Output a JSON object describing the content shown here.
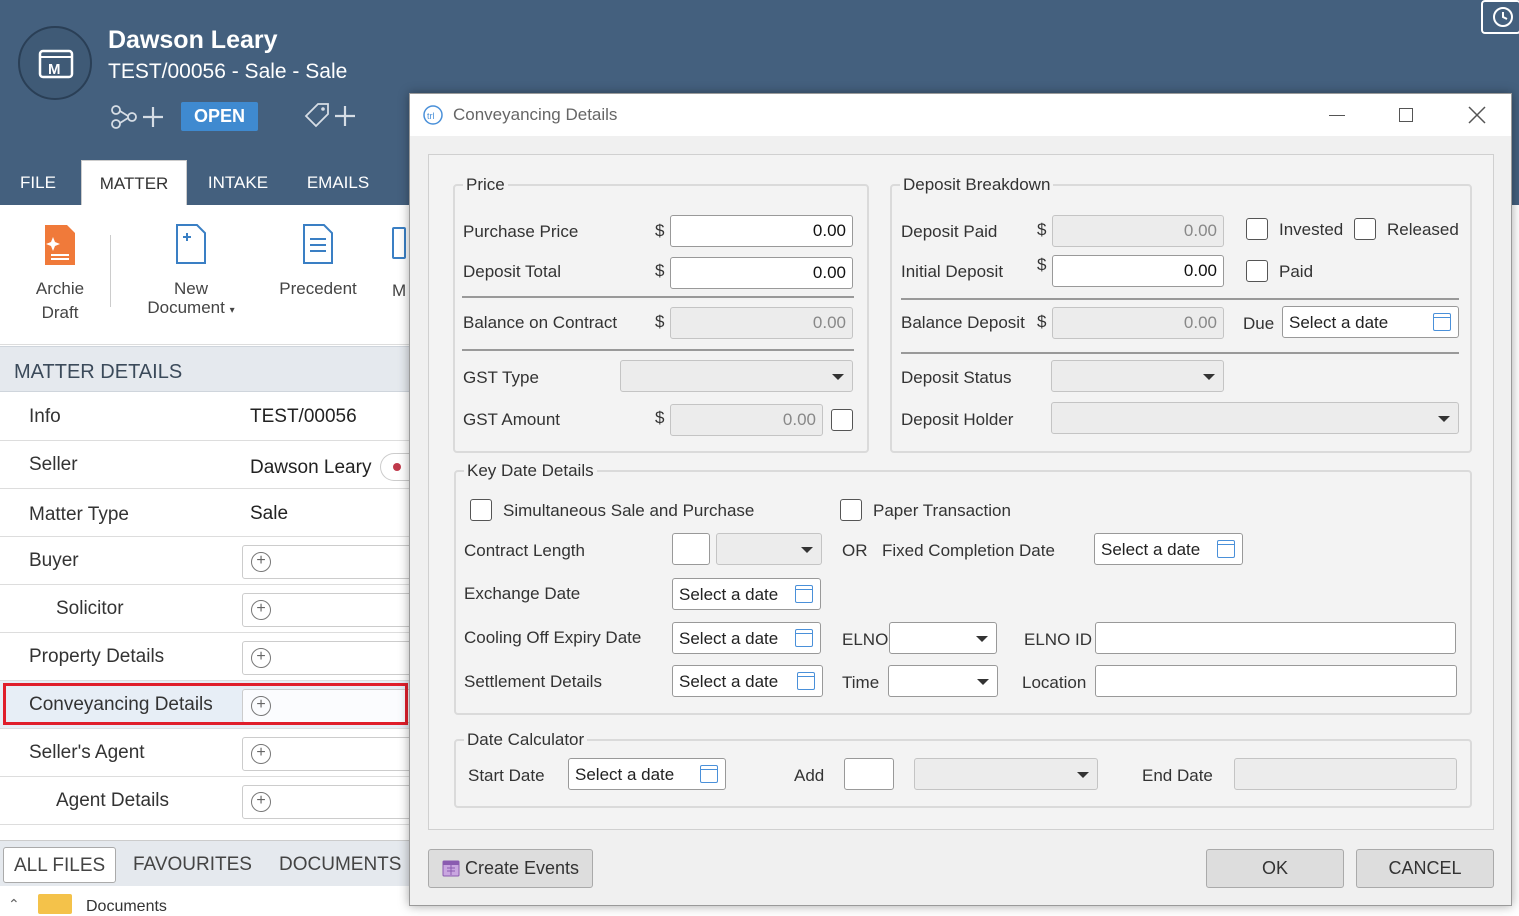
{
  "header": {
    "client_name": "Dawson Leary",
    "matter_subtitle": "TEST/00056 - Sale - Sale",
    "status_badge": "OPEN"
  },
  "tabs": [
    "FILE",
    "MATTER",
    "INTAKE",
    "EMAILS"
  ],
  "ribbon": {
    "archie_line1": "Archie",
    "archie_line2": "Draft",
    "new_doc_line1": "New",
    "new_doc_line2": "Document",
    "precedent": "Precedent",
    "clipped": "M"
  },
  "matter_details": {
    "title": "MATTER DETAILS",
    "rows": [
      {
        "label": "Info",
        "value": "TEST/00056"
      },
      {
        "label": "Seller",
        "value": "Dawson Leary"
      },
      {
        "label": "Matter Type",
        "value": "Sale"
      },
      {
        "label": "Buyer"
      },
      {
        "label": "Solicitor"
      },
      {
        "label": "Property Details"
      },
      {
        "label": "Conveyancing Details"
      },
      {
        "label": "Seller's Agent"
      },
      {
        "label": "Agent Details"
      }
    ]
  },
  "file_tabs": [
    "ALL FILES",
    "FAVOURITES",
    "DOCUMENTS"
  ],
  "docs_folder": "Documents",
  "dialog": {
    "title": "Conveyancing Details",
    "price": {
      "legend": "Price",
      "purchase_price_label": "Purchase Price",
      "purchase_price": "0.00",
      "deposit_total_label": "Deposit Total",
      "deposit_total": "0.00",
      "balance_label": "Balance on Contract",
      "balance": "0.00",
      "gst_type_label": "GST Type",
      "gst_amount_label": "GST Amount",
      "gst_amount": "0.00",
      "currency": "$"
    },
    "deposit": {
      "legend": "Deposit Breakdown",
      "deposit_paid_label": "Deposit Paid",
      "deposit_paid": "0.00",
      "invested_label": "Invested",
      "released_label": "Released",
      "initial_deposit_label": "Initial Deposit",
      "initial_deposit": "0.00",
      "paid_label": "Paid",
      "balance_deposit_label": "Balance Deposit",
      "balance_deposit": "0.00",
      "due_label": "Due",
      "status_label": "Deposit Status",
      "holder_label": "Deposit Holder"
    },
    "key_dates": {
      "legend": "Key Date Details",
      "simultaneous_label": "Simultaneous Sale and Purchase",
      "paper_label": "Paper Transaction",
      "contract_length_label": "Contract Length",
      "or_label": "OR",
      "fixed_completion_label": "Fixed Completion Date",
      "exchange_label": "Exchange Date",
      "cooling_label": "Cooling Off Expiry Date",
      "elno_label": "ELNO",
      "elno_id_label": "ELNO ID",
      "settlement_label": "Settlement Details",
      "time_label": "Time",
      "location_label": "Location"
    },
    "calculator": {
      "legend": "Date Calculator",
      "start_label": "Start Date",
      "add_label": "Add",
      "end_label": "End Date"
    },
    "date_placeholder": "Select a date",
    "create_events": "Create Events",
    "ok": "OK",
    "cancel": "CANCEL"
  }
}
